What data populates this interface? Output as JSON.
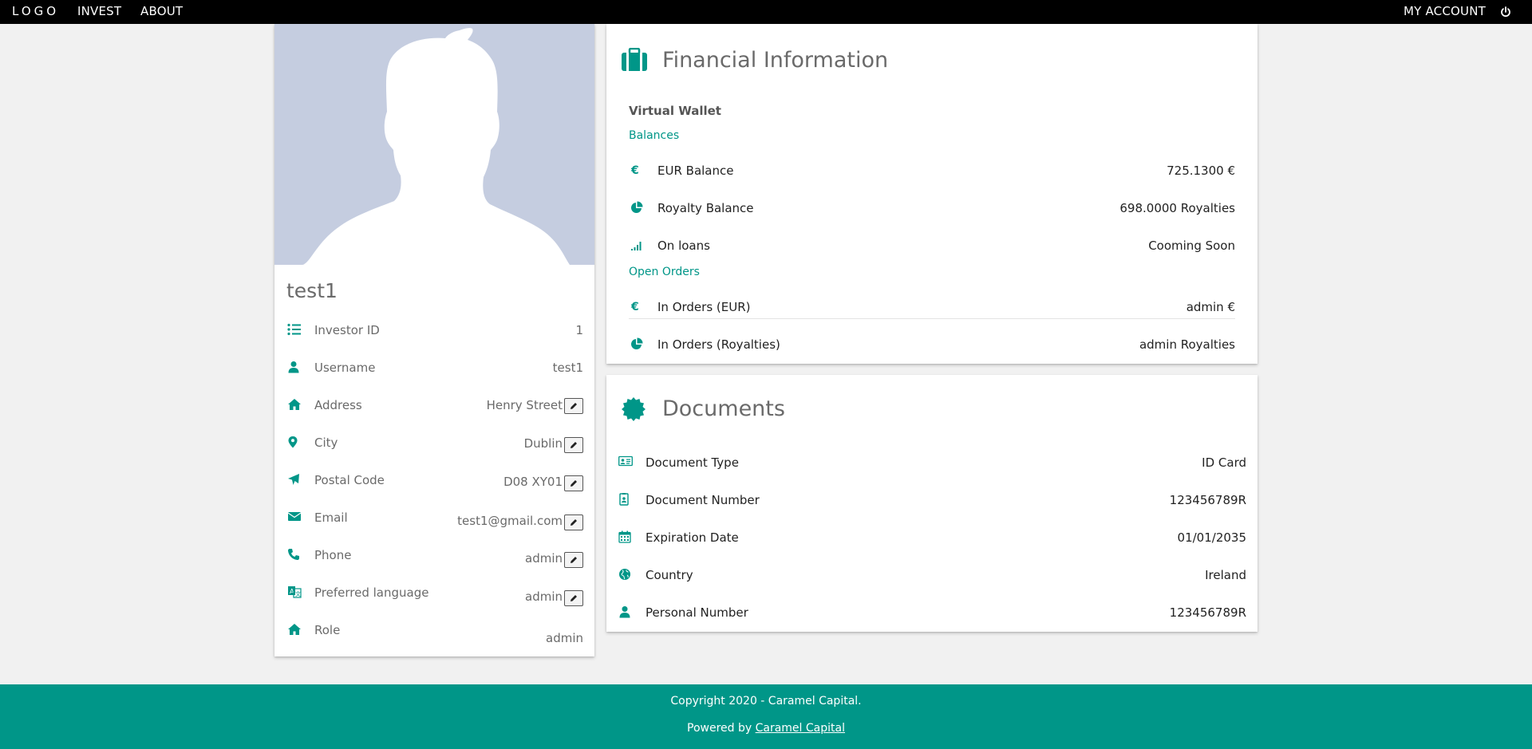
{
  "nav": {
    "logo": "LOGO",
    "invest": "INVEST",
    "about": "ABOUT",
    "my_account": "MY ACCOUNT",
    "power_icon": "power-icon"
  },
  "profile": {
    "name": "test1",
    "avatar_icon": "person-silhouette",
    "rows": [
      {
        "label": "Investor ID",
        "value": "1",
        "icon": "list-icon",
        "editable": false
      },
      {
        "label": "Username",
        "value": "test1",
        "icon": "user-icon",
        "editable": false
      },
      {
        "label": "Address",
        "value": "Henry Street",
        "icon": "home-icon",
        "editable": true
      },
      {
        "label": "City",
        "value": "Dublin",
        "icon": "map-marker-icon",
        "editable": true
      },
      {
        "label": "Postal Code",
        "value": "D08 XY01",
        "icon": "plane-icon",
        "editable": true
      },
      {
        "label": "Email",
        "value": "test1@gmail.com",
        "icon": "envelope-icon",
        "editable": true
      },
      {
        "label": "Phone",
        "value": "admin",
        "icon": "phone-icon",
        "editable": true
      },
      {
        "label": "Preferred language",
        "value": "admin",
        "icon": "translate-icon",
        "editable": true
      },
      {
        "label": "Role",
        "value": "admin",
        "icon": "home-icon",
        "editable": false
      }
    ]
  },
  "financial": {
    "title": "Financial Information",
    "title_icon": "briefcase-icon",
    "wallet_heading": "Virtual Wallet",
    "balances_heading": "Balances",
    "balances": [
      {
        "label": "EUR Balance",
        "value": "725.1300 €",
        "icon": "euro-icon"
      },
      {
        "label": "Royalty Balance",
        "value": "698.0000 Royalties",
        "icon": "pie-chart-icon"
      },
      {
        "label": "On loans",
        "value": "Cooming Soon",
        "icon": "signal-icon"
      }
    ],
    "orders_heading": "Open Orders",
    "orders": [
      {
        "label": "In Orders (EUR)",
        "value": "admin €",
        "icon": "euro-icon"
      },
      {
        "label": "In Orders (Royalties)",
        "value": "admin Royalties",
        "icon": "pie-chart-icon"
      }
    ]
  },
  "documents": {
    "title": "Documents",
    "title_icon": "certificate-icon",
    "rows": [
      {
        "label": "Document Type",
        "value": "ID Card",
        "icon": "id-card-icon"
      },
      {
        "label": "Document Number",
        "value": "123456789R",
        "icon": "id-badge-icon"
      },
      {
        "label": "Expiration Date",
        "value": "01/01/2035",
        "icon": "calendar-icon"
      },
      {
        "label": "Country",
        "value": "Ireland",
        "icon": "globe-icon"
      },
      {
        "label": "Personal Number",
        "value": "123456789R",
        "icon": "user-icon"
      }
    ]
  },
  "footer": {
    "copyright": "Copyright 2020 - Caramel Capital.",
    "powered_prefix": "Powered by ",
    "powered_link": "Caramel Capital"
  },
  "colors": {
    "accent": "#009688",
    "navbar": "#000000",
    "avatar_bg": "#c5cde0",
    "page_bg": "#f1f1f1"
  }
}
